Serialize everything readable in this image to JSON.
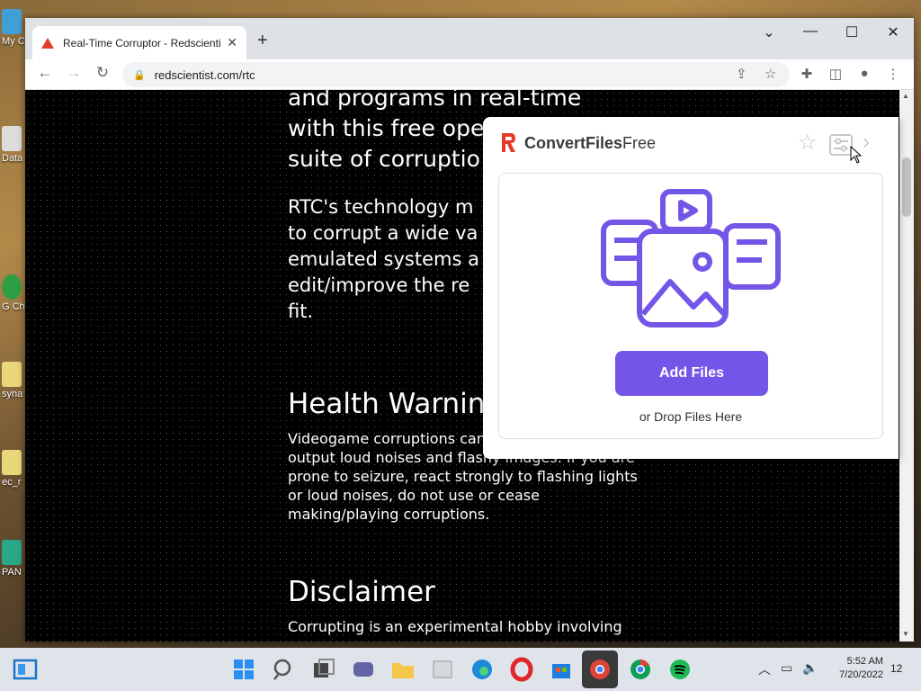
{
  "desktop": {
    "icons": [
      "My C",
      "Data",
      "G\nCh",
      "syna",
      "ec_r",
      "PAN"
    ]
  },
  "browser": {
    "tab_title": "Real-Time Corruptor - Redscientist",
    "url": "redscientist.com/rtc",
    "window_controls": {
      "minimize": "—",
      "maximize": "☐",
      "close": "✕",
      "tab_search": "⌄"
    }
  },
  "page": {
    "intro_lines": [
      "and programs in real-time",
      "with this free ope",
      "suite of corruptio"
    ],
    "para_lines": [
      "RTC's technology m",
      "to corrupt a wide va",
      "emulated systems a",
      "edit/improve the re",
      "fit."
    ],
    "health_heading": "Health Warnin",
    "health_text_lines": [
      "Videogame corruptions can",
      "output loud noises and flashy images. If you are",
      "prone to seizure, react strongly to flashing lights",
      "or loud noises, do not use or cease",
      "making/playing corruptions."
    ],
    "disclaimer_heading": "Disclaimer",
    "disclaimer_text": "Corrupting is an experimental hobby involving"
  },
  "popup": {
    "brand_bold": "ConvertFiles",
    "brand_rest": "Free",
    "add_button": "Add Files",
    "drop_hint": "or Drop Files Here",
    "accent_color": "#7356e8"
  },
  "taskbar": {
    "time": "5:52 AM",
    "date": "7/20/2022",
    "notifications": "12"
  }
}
